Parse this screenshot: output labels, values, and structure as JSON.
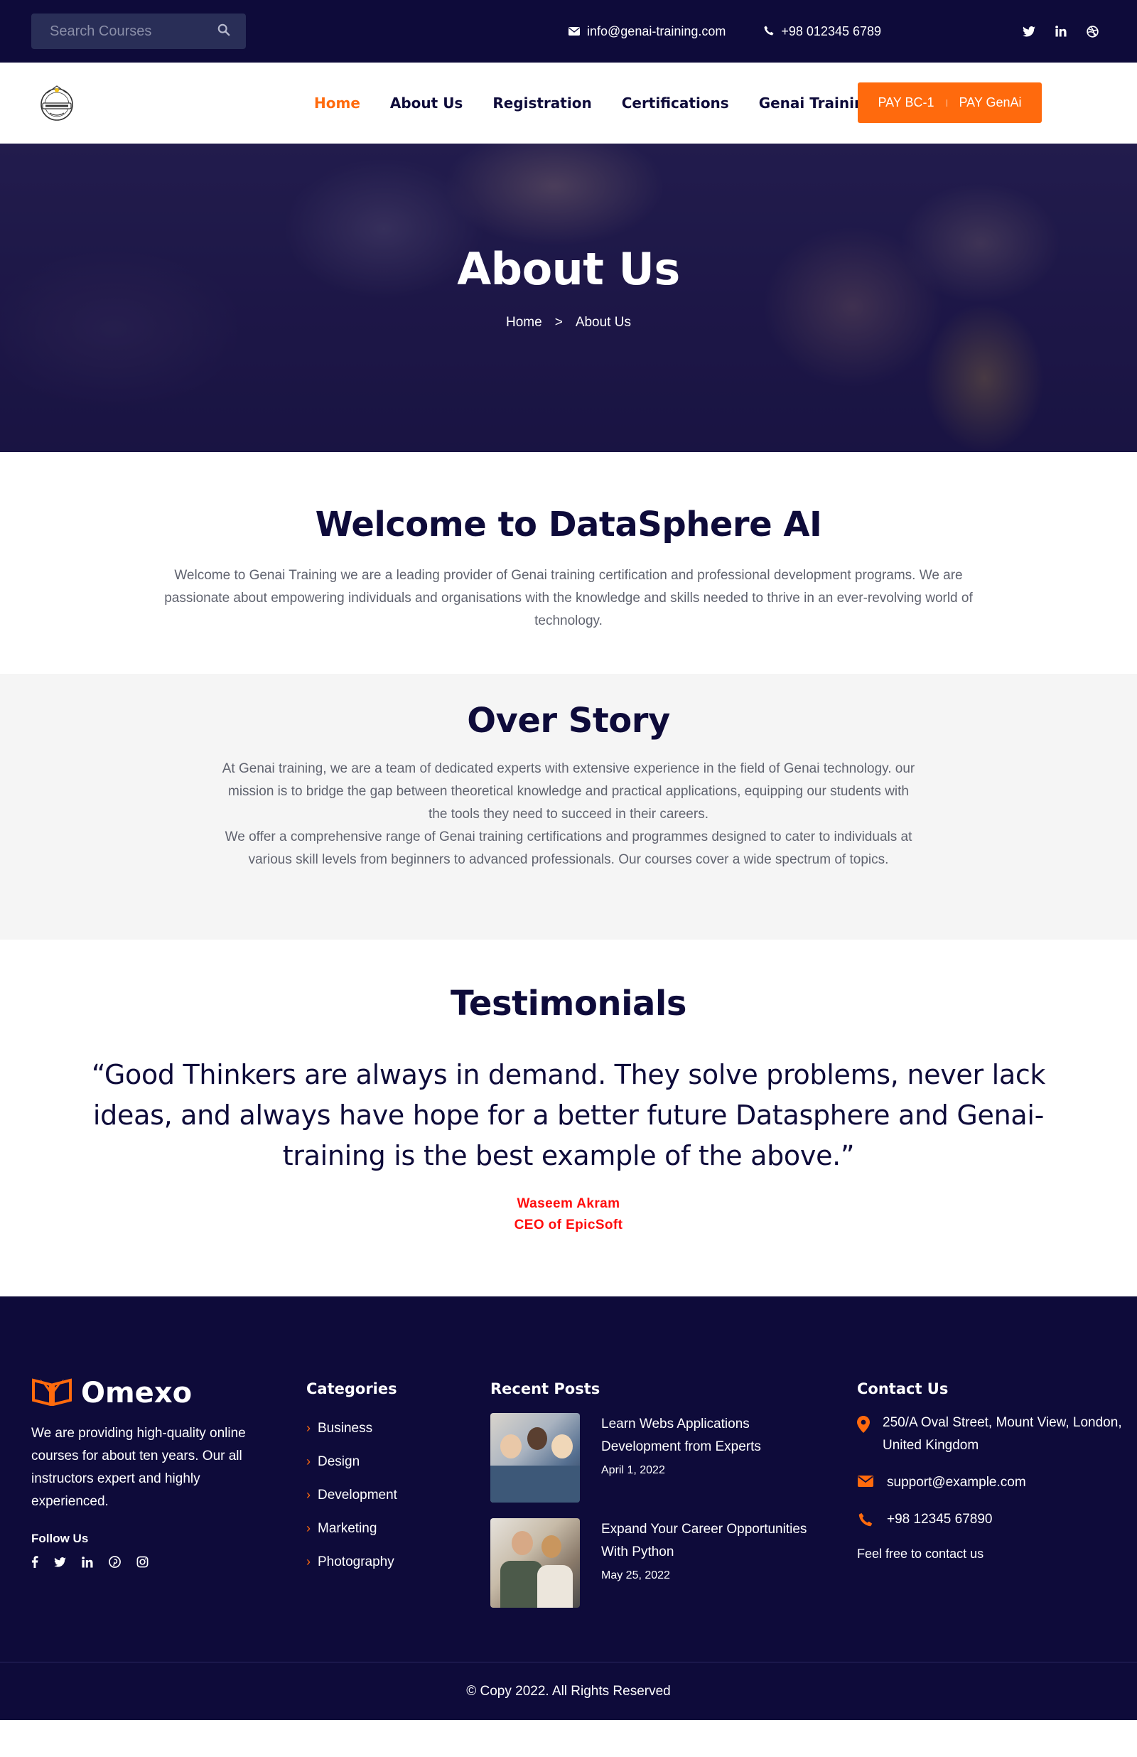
{
  "topbar": {
    "search_placeholder": "Search Courses",
    "email": "info@genai-training.com",
    "phone": "+98 012345 6789",
    "social_icons": [
      "twitter-icon",
      "linkedin-icon",
      "dribbble-icon"
    ]
  },
  "nav": {
    "items": [
      {
        "label": "Home",
        "active": true
      },
      {
        "label": "About Us"
      },
      {
        "label": "Registration"
      },
      {
        "label": "Certifications"
      },
      {
        "label": "Genai Trainings"
      }
    ],
    "pay_bc1": "PAY BC-1",
    "pay_genai": "PAY GenAi"
  },
  "hero": {
    "title": "About Us",
    "breadcrumb_home": "Home",
    "breadcrumb_sep": ">",
    "breadcrumb_current": "About Us"
  },
  "welcome": {
    "title": "Welcome to DataSphere AI",
    "text": "Welcome to Genai Training we are a leading provider of Genai training certification and professional development programs. We are passionate about empowering individuals and organisations with the knowledge and skills needed to thrive in an ever-revolving world of technology."
  },
  "story": {
    "title": "Over Story",
    "text1": "At Genai training, we are a team of dedicated experts with extensive experience in the field of Genai technology. our mission is to bridge the gap between theoretical knowledge and practical applications, equipping our students with the tools they need to succeed in their careers.",
    "text2": "We offer a comprehensive range of Genai training certifications and programmes designed to cater to individuals at various skill levels from beginners to advanced professionals. Our courses cover a wide spectrum of topics."
  },
  "testimonials": {
    "title": "Testimonials",
    "quote": "“Good Thinkers are always in demand. They solve problems, never lack ideas, and always have hope for a better future Datasphere and Genai-training is the best example of the above.”",
    "author": "Waseem Akram",
    "role": "CEO of EpicSoft"
  },
  "footer": {
    "brand": "Omexo",
    "description": "We are providing high-quality online courses for about ten years. Our all instructors expert and highly experienced.",
    "follow_title": "Follow Us",
    "follow_icons": [
      "facebook-icon",
      "twitter-icon",
      "linkedin-icon",
      "pinterest-icon",
      "instagram-icon"
    ],
    "categories_title": "Categories",
    "categories": [
      "Business",
      "Design",
      "Development",
      "Marketing",
      "Photography"
    ],
    "posts_title": "Recent Posts",
    "posts": [
      {
        "title": "Learn Webs Applications Development from Experts",
        "date": "April 1, 2022"
      },
      {
        "title": "Expand Your Career Opportunities With Python",
        "date": "May 25, 2022"
      }
    ],
    "contact_title": "Contact Us",
    "address": "250/A Oval Street, Mount View, London, United Kingdom",
    "contact_email": "support@example.com",
    "contact_phone": "+98 12345 67890",
    "contact_note": "Feel free to contact us",
    "copyright": "© Copy 2022. All Rights Reserved"
  },
  "colors": {
    "navy": "#0e0b3a",
    "accent": "#ff6a0d",
    "author_red": "#ff0c0c"
  }
}
